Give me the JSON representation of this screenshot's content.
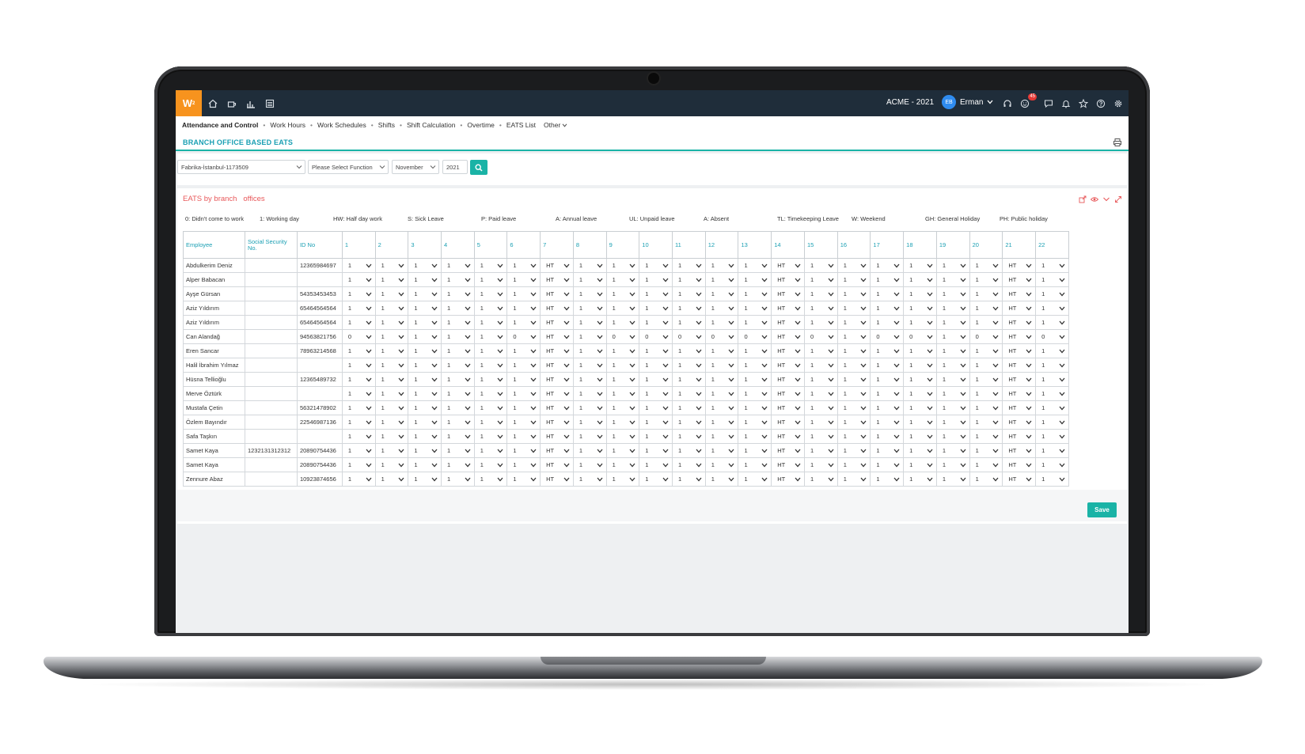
{
  "topbar": {
    "logo_text": "W",
    "company": "ACME - 2021",
    "user_initials": "EB",
    "user_name": "Erman",
    "notification_count": "45",
    "nav_icons": [
      "home-icon",
      "coffee-icon",
      "bar-chart-icon",
      "list-icon"
    ],
    "right_icons": [
      "headset-icon",
      "smiley-icon",
      "chat-icon",
      "bell-icon",
      "star-icon",
      "help-icon",
      "gear-icon"
    ]
  },
  "breadcrumb": {
    "main": "Attendance and Control",
    "items": [
      "Work Hours",
      "Work Schedules",
      "Shifts",
      "Shift Calculation",
      "Overtime",
      "EATS List"
    ],
    "other": "Other"
  },
  "page_title": "BRANCH OFFICE BASED EATS",
  "filters": {
    "branch": "Fabrika-İstanbul-1173509",
    "function": "Please Select Function",
    "month": "November",
    "year": "2021"
  },
  "panel": {
    "title": "EATS by branch   offices"
  },
  "legend": [
    "0: Didn't come to work",
    "1: Working day",
    "HW: Half day work",
    "S: Sick Leave",
    "P: Paid leave",
    "A: Annual leave",
    "UL: Unpaid leave",
    "A: Absent",
    "TL: Timekeeping Leave",
    "W: Weekend",
    "GH: General Holiday",
    "PH: Public holiday"
  ],
  "table": {
    "headers": [
      "Employee",
      "Social Security No.",
      "ID No"
    ],
    "days": [
      "1",
      "2",
      "3",
      "4",
      "5",
      "6",
      "7",
      "8",
      "9",
      "10",
      "11",
      "12",
      "13",
      "14",
      "15",
      "16",
      "17",
      "18",
      "19",
      "20",
      "21",
      "22"
    ],
    "rows": [
      {
        "employee": "Abdulkerim Deniz",
        "ssn": "",
        "id": "12365984697",
        "values": [
          "1",
          "1",
          "1",
          "1",
          "1",
          "1",
          "HT",
          "1",
          "1",
          "1",
          "1",
          "1",
          "1",
          "HT",
          "1",
          "1",
          "1",
          "1",
          "1",
          "1",
          "HT",
          "1"
        ]
      },
      {
        "employee": "Alper Babacan",
        "ssn": "",
        "id": "",
        "values": [
          "1",
          "1",
          "1",
          "1",
          "1",
          "1",
          "HT",
          "1",
          "1",
          "1",
          "1",
          "1",
          "1",
          "HT",
          "1",
          "1",
          "1",
          "1",
          "1",
          "1",
          "HT",
          "1"
        ]
      },
      {
        "employee": "Ayşe Gürsan",
        "ssn": "",
        "id": "54353453453",
        "values": [
          "1",
          "1",
          "1",
          "1",
          "1",
          "1",
          "HT",
          "1",
          "1",
          "1",
          "1",
          "1",
          "1",
          "HT",
          "1",
          "1",
          "1",
          "1",
          "1",
          "1",
          "HT",
          "1"
        ]
      },
      {
        "employee": "Aziz Yıldırım",
        "ssn": "",
        "id": "65464564564",
        "values": [
          "1",
          "1",
          "1",
          "1",
          "1",
          "1",
          "HT",
          "1",
          "1",
          "1",
          "1",
          "1",
          "1",
          "HT",
          "1",
          "1",
          "1",
          "1",
          "1",
          "1",
          "HT",
          "1"
        ]
      },
      {
        "employee": "Aziz Yıldırım",
        "ssn": "",
        "id": "65464564564",
        "values": [
          "1",
          "1",
          "1",
          "1",
          "1",
          "1",
          "HT",
          "1",
          "1",
          "1",
          "1",
          "1",
          "1",
          "HT",
          "1",
          "1",
          "1",
          "1",
          "1",
          "1",
          "HT",
          "1"
        ]
      },
      {
        "employee": "Can Alandağ",
        "ssn": "",
        "id": "94563821756",
        "values": [
          "0",
          "1",
          "1",
          "1",
          "1",
          "0",
          "HT",
          "1",
          "0",
          "0",
          "0",
          "0",
          "0",
          "HT",
          "0",
          "1",
          "0",
          "0",
          "1",
          "0",
          "HT",
          "0"
        ]
      },
      {
        "employee": "Eren Sancar",
        "ssn": "",
        "id": "78963214568",
        "values": [
          "1",
          "1",
          "1",
          "1",
          "1",
          "1",
          "HT",
          "1",
          "1",
          "1",
          "1",
          "1",
          "1",
          "HT",
          "1",
          "1",
          "1",
          "1",
          "1",
          "1",
          "HT",
          "1"
        ]
      },
      {
        "employee": "Halil İbrahim Yılmaz",
        "ssn": "",
        "id": "",
        "values": [
          "1",
          "1",
          "1",
          "1",
          "1",
          "1",
          "HT",
          "1",
          "1",
          "1",
          "1",
          "1",
          "1",
          "HT",
          "1",
          "1",
          "1",
          "1",
          "1",
          "1",
          "HT",
          "1"
        ]
      },
      {
        "employee": "Hüsna Tellioğlu",
        "ssn": "",
        "id": "12365489732",
        "values": [
          "1",
          "1",
          "1",
          "1",
          "1",
          "1",
          "HT",
          "1",
          "1",
          "1",
          "1",
          "1",
          "1",
          "HT",
          "1",
          "1",
          "1",
          "1",
          "1",
          "1",
          "HT",
          "1"
        ]
      },
      {
        "employee": "Merve Öztürk",
        "ssn": "",
        "id": "",
        "values": [
          "1",
          "1",
          "1",
          "1",
          "1",
          "1",
          "HT",
          "1",
          "1",
          "1",
          "1",
          "1",
          "1",
          "HT",
          "1",
          "1",
          "1",
          "1",
          "1",
          "1",
          "HT",
          "1"
        ]
      },
      {
        "employee": "Mustafa Çetin",
        "ssn": "",
        "id": "56321478902",
        "values": [
          "1",
          "1",
          "1",
          "1",
          "1",
          "1",
          "HT",
          "1",
          "1",
          "1",
          "1",
          "1",
          "1",
          "HT",
          "1",
          "1",
          "1",
          "1",
          "1",
          "1",
          "HT",
          "1"
        ]
      },
      {
        "employee": "Özlem Bayındır",
        "ssn": "",
        "id": "22546987136",
        "values": [
          "1",
          "1",
          "1",
          "1",
          "1",
          "1",
          "HT",
          "1",
          "1",
          "1",
          "1",
          "1",
          "1",
          "HT",
          "1",
          "1",
          "1",
          "1",
          "1",
          "1",
          "HT",
          "1"
        ]
      },
      {
        "employee": "Safa Taşkın",
        "ssn": "",
        "id": "",
        "values": [
          "1",
          "1",
          "1",
          "1",
          "1",
          "1",
          "HT",
          "1",
          "1",
          "1",
          "1",
          "1",
          "1",
          "HT",
          "1",
          "1",
          "1",
          "1",
          "1",
          "1",
          "HT",
          "1"
        ]
      },
      {
        "employee": "Samet Kaya",
        "ssn": "1232131312312",
        "id": "20890754436",
        "values": [
          "1",
          "1",
          "1",
          "1",
          "1",
          "1",
          "HT",
          "1",
          "1",
          "1",
          "1",
          "1",
          "1",
          "HT",
          "1",
          "1",
          "1",
          "1",
          "1",
          "1",
          "HT",
          "1"
        ]
      },
      {
        "employee": "Samet Kaya",
        "ssn": "",
        "id": "20890754436",
        "values": [
          "1",
          "1",
          "1",
          "1",
          "1",
          "1",
          "HT",
          "1",
          "1",
          "1",
          "1",
          "1",
          "1",
          "HT",
          "1",
          "1",
          "1",
          "1",
          "1",
          "1",
          "HT",
          "1"
        ]
      },
      {
        "employee": "Zennure Abaz",
        "ssn": "",
        "id": "10923874656",
        "values": [
          "1",
          "1",
          "1",
          "1",
          "1",
          "1",
          "HT",
          "1",
          "1",
          "1",
          "1",
          "1",
          "1",
          "HT",
          "1",
          "1",
          "1",
          "1",
          "1",
          "1",
          "HT",
          "1"
        ]
      }
    ]
  },
  "save_label": "Save",
  "colors": {
    "topbar": "#1f2d3a",
    "logo": "#f7931e",
    "accent": "#1ab3a6",
    "header_text": "#1a9fb3",
    "panel_title": "#e8585a"
  }
}
